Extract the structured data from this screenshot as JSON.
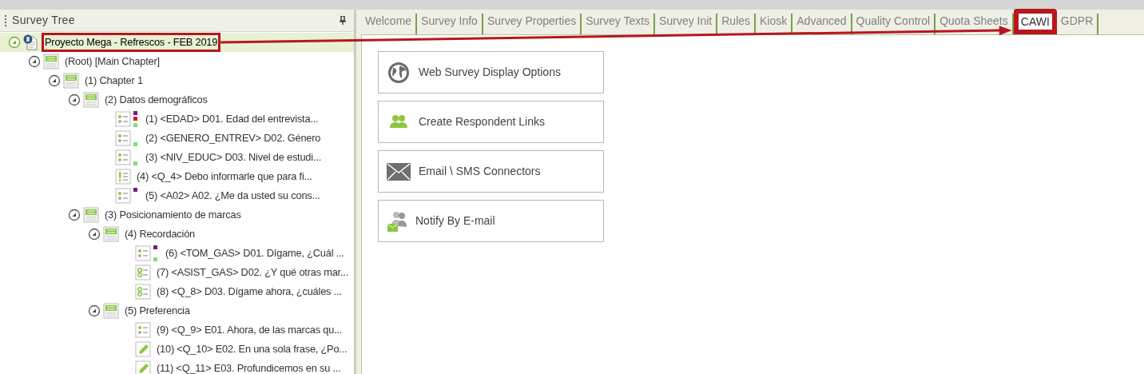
{
  "survey_tree": {
    "title": "Survey Tree",
    "items": [
      {
        "label": "Proyecto Mega - Refrescos - FEB 2019",
        "kind": "project",
        "selected": true,
        "highlighted": true,
        "expanded": true,
        "children": [
          {
            "label": "(Root) [Main Chapter]",
            "kind": "chapter",
            "selected": false,
            "expanded": true,
            "children": [
              {
                "label": "(1) Chapter 1",
                "kind": "chapter",
                "selected": false,
                "expanded": true,
                "children": [
                  {
                    "label": "(2) Datos demográficos",
                    "kind": "chapter",
                    "selected": false,
                    "expanded": true,
                    "children": [
                      {
                        "label": "(1) <EDAD> D01. Edad del entrevista...",
                        "kind": "single",
                        "selected": false,
                        "markers": [
                          {
                            "kind": "top",
                            "color": "#7b1a8b"
                          },
                          {
                            "kind": "middle",
                            "color": "#e8141c"
                          },
                          {
                            "kind": "bottom",
                            "color": "#7ee07e"
                          }
                        ]
                      },
                      {
                        "label": "(2) <GENERO_ENTREV> D02. Género",
                        "kind": "single",
                        "selected": false,
                        "markers": [
                          {
                            "kind": "bottom",
                            "color": "#7ee07e"
                          }
                        ]
                      },
                      {
                        "label": "(3) <NIV_EDUC> D03. Nivel de estudi...",
                        "kind": "single",
                        "selected": false,
                        "markers": [
                          {
                            "kind": "bottom",
                            "color": "#7ee07e"
                          }
                        ]
                      },
                      {
                        "label": "(4) <Q_4> Debo informarle que para fi...",
                        "kind": "info",
                        "selected": false
                      },
                      {
                        "label": "(5) <A02> A02. ¿Me da usted su cons...",
                        "kind": "single",
                        "selected": false,
                        "markers": [
                          {
                            "kind": "top",
                            "color": "#7b1a8b"
                          }
                        ]
                      }
                    ]
                  },
                  {
                    "label": "(3) Posicionamiento de marcas",
                    "kind": "chapter",
                    "selected": false,
                    "expanded": true,
                    "children": [
                      {
                        "label": "(4) Recordación",
                        "kind": "chapter",
                        "selected": false,
                        "expanded": true,
                        "children": [
                          {
                            "label": "(6) <TOM_GAS> D01. Dígame, ¿Cuál ...",
                            "kind": "single",
                            "selected": false,
                            "markers": [
                              {
                                "kind": "top",
                                "color": "#7b1a8b"
                              },
                              {
                                "kind": "bottom",
                                "color": "#7ee07e"
                              }
                            ]
                          },
                          {
                            "label": "(7) <ASIST_GAS> D02. ¿Y qué otras mar...",
                            "kind": "multi",
                            "selected": false
                          },
                          {
                            "label": "(8) <Q_8> D03. Dígame ahora, ¿cuáles ...",
                            "kind": "multi",
                            "selected": false
                          }
                        ]
                      },
                      {
                        "label": "(5) Preferencia",
                        "kind": "chapter",
                        "selected": false,
                        "expanded": true,
                        "children": [
                          {
                            "label": "(9) <Q_9> E01. Ahora, de las marcas qu...",
                            "kind": "single",
                            "selected": false
                          },
                          {
                            "label": "(10) <Q_10> E02. En una sola frase, ¿Po...",
                            "kind": "open",
                            "selected": false
                          },
                          {
                            "label": "(11) <Q_11> E03. Profundicemos en su ...",
                            "kind": "open",
                            "selected": false
                          }
                        ]
                      }
                    ]
                  }
                ]
              }
            ]
          }
        ]
      }
    ]
  },
  "tabs": [
    {
      "label": "Welcome",
      "selected": false,
      "highlighted": false
    },
    {
      "label": "Survey Info",
      "selected": false,
      "highlighted": false
    },
    {
      "label": "Survey Properties",
      "selected": false,
      "highlighted": false
    },
    {
      "label": "Survey Texts",
      "selected": false,
      "highlighted": false
    },
    {
      "label": "Survey Init",
      "selected": false,
      "highlighted": false
    },
    {
      "label": "Rules",
      "selected": false,
      "highlighted": false
    },
    {
      "label": "Kiosk",
      "selected": false,
      "highlighted": false
    },
    {
      "label": "Advanced",
      "selected": false,
      "highlighted": false
    },
    {
      "label": "Quality Control",
      "selected": false,
      "highlighted": false
    },
    {
      "label": "Quota Sheets",
      "selected": false,
      "highlighted": false
    },
    {
      "label": "CAWI",
      "selected": true,
      "highlighted": true
    },
    {
      "label": "GDPR",
      "selected": false,
      "highlighted": false
    }
  ],
  "actions": [
    {
      "label": "Web Survey Display Options",
      "kind": "globe"
    },
    {
      "label": "Create Respondent Links",
      "kind": "people"
    },
    {
      "label": "Email \\ SMS Connectors",
      "kind": "envelope"
    },
    {
      "label": "Notify By E-mail",
      "kind": "notify"
    }
  ],
  "annotation_arrow": true
}
